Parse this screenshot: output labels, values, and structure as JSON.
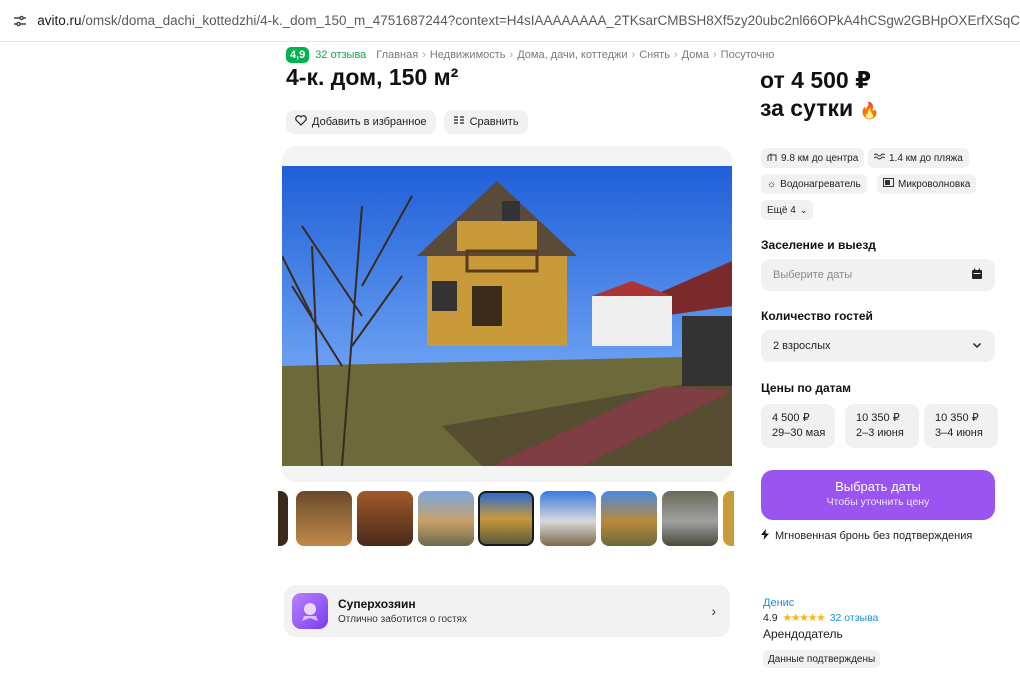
{
  "browser": {
    "url_host": "avito.ru",
    "url_path": "/omsk/doma_dachi_kottedzhi/4-k._dom_150_m_4751687244?context=H4sIAAAAAAAA_2TKsarCMBSH8Xf5zy20ubc2nl66OPkA4hCSgw2GBHpOXErfXSqCg-vv-xz90So0Ev"
  },
  "listing": {
    "rating": "4,9",
    "reviews": "32 отзыва",
    "breadcrumbs": [
      "Главная",
      "Недвижимость",
      "Дома, дачи, коттеджи",
      "Снять",
      "Дома",
      "Посуточно"
    ],
    "title": "4-к. дом, 150 м²",
    "favorite_label": "Добавить в избранное",
    "compare_label": "Сравнить"
  },
  "superhost": {
    "title": "Суперхозяин",
    "subtitle": "Отлично заботится о гостях"
  },
  "booking": {
    "price_line1": "от 4 500 ₽",
    "price_line2": "за сутки",
    "features": [
      "9.8 км до центра",
      "1.4 км до пляжа",
      "Водонагреватель",
      "Микроволновка",
      "Ещё 4"
    ],
    "checkin_label": "Заселение и выезд",
    "checkin_placeholder": "Выберите даты",
    "guests_label": "Количество гостей",
    "guests_value": "2 взрослых",
    "prices_label": "Цены по датам",
    "date_prices": [
      {
        "price": "4 500 ₽",
        "dates": "29–30 мая"
      },
      {
        "price": "10 350 ₽",
        "dates": "2–3 июня"
      },
      {
        "price": "10 350 ₽",
        "dates": "3–4 июня"
      }
    ],
    "cta_title": "Выбрать даты",
    "cta_subtitle": "Чтобы уточнить цену",
    "instant": "Мгновенная бронь без подтверждения"
  },
  "host": {
    "name": "Денис",
    "rating": "4.9",
    "stars": "★★★★★",
    "reviews": "32 отзыва",
    "role": "Арендодатель",
    "verified": "Данные подтверждены"
  },
  "colors": {
    "accent": "#9a55f1",
    "rating_green": "#00b34d",
    "link_blue": "#1a8fd6"
  }
}
